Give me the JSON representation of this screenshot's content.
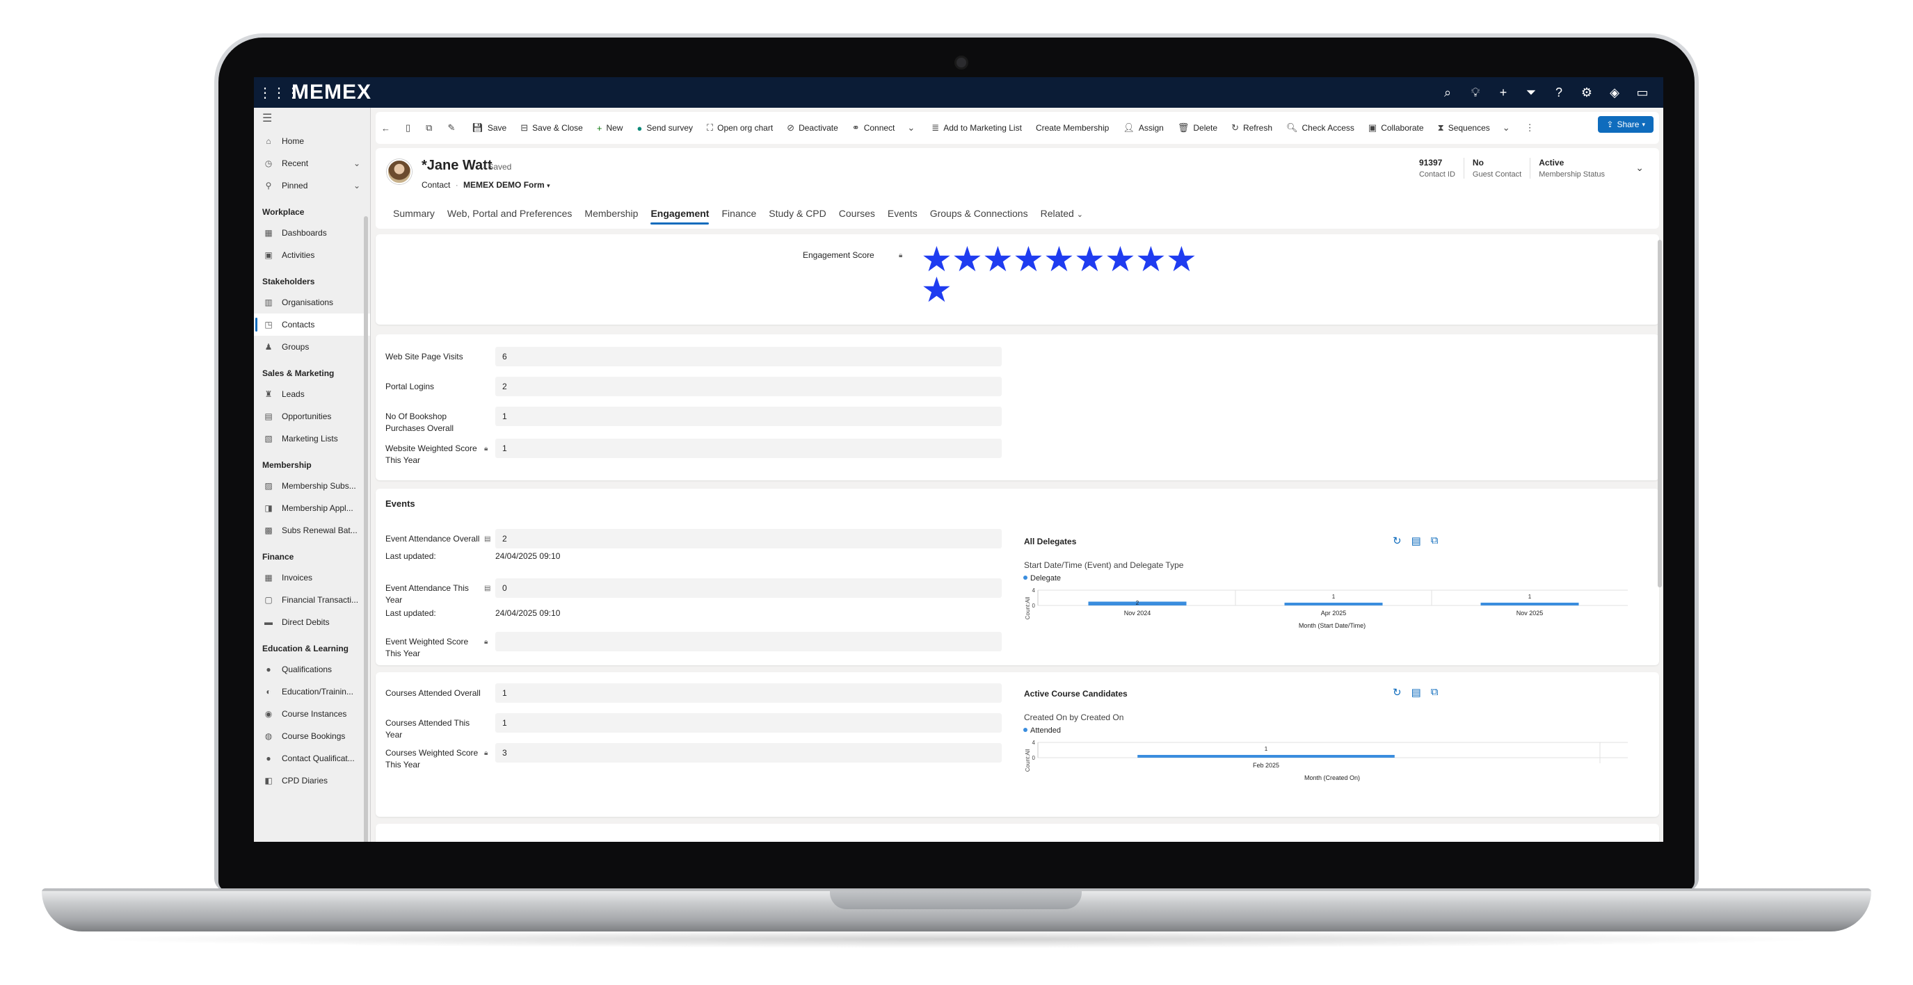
{
  "app": {
    "brand": "MEMEX"
  },
  "nav": {
    "top": [
      {
        "label": "Home",
        "icon": "home-icon"
      },
      {
        "label": "Recent",
        "icon": "clock-icon",
        "expandable": true
      },
      {
        "label": "Pinned",
        "icon": "pin-icon",
        "expandable": true
      }
    ],
    "groups": [
      {
        "title": "Workplace",
        "items": [
          {
            "label": "Dashboards"
          },
          {
            "label": "Activities"
          }
        ]
      },
      {
        "title": "Stakeholders",
        "items": [
          {
            "label": "Organisations"
          },
          {
            "label": "Contacts",
            "selected": true
          },
          {
            "label": "Groups"
          }
        ]
      },
      {
        "title": "Sales & Marketing",
        "items": [
          {
            "label": "Leads"
          },
          {
            "label": "Opportunities"
          },
          {
            "label": "Marketing Lists"
          }
        ]
      },
      {
        "title": "Membership",
        "items": [
          {
            "label": "Membership Subs..."
          },
          {
            "label": "Membership Appl..."
          },
          {
            "label": "Subs Renewal Bat..."
          }
        ]
      },
      {
        "title": "Finance",
        "items": [
          {
            "label": "Invoices"
          },
          {
            "label": "Financial Transacti..."
          },
          {
            "label": "Direct Debits"
          }
        ]
      },
      {
        "title": "Education & Learning",
        "items": [
          {
            "label": "Qualifications"
          },
          {
            "label": "Education/Trainin..."
          },
          {
            "label": "Course Instances"
          },
          {
            "label": "Course Bookings"
          },
          {
            "label": "Contact Qualificat..."
          },
          {
            "label": "CPD Diaries"
          }
        ]
      }
    ]
  },
  "commands": [
    {
      "label": "",
      "icon": "back-arrow-icon"
    },
    {
      "label": "",
      "icon": "form-icon"
    },
    {
      "label": "",
      "icon": "open-new-window-icon"
    },
    {
      "label": "",
      "icon": "edit-form-icon"
    },
    {
      "label": "Save",
      "icon": "save-icon"
    },
    {
      "label": "Save & Close",
      "icon": "save-close-icon"
    },
    {
      "label": "New",
      "icon": "plus-icon"
    },
    {
      "label": "Send survey",
      "icon": "survey-icon"
    },
    {
      "label": "Open org chart",
      "icon": "org-chart-icon"
    },
    {
      "label": "Deactivate",
      "icon": "deactivate-icon"
    },
    {
      "label": "Connect",
      "icon": "connect-icon"
    },
    {
      "label": "",
      "icon": "chevron-down-icon"
    },
    {
      "label": "Add to Marketing List",
      "icon": "marketing-list-icon"
    },
    {
      "label": "Create Membership",
      "icon": ""
    },
    {
      "label": "Assign",
      "icon": "assign-icon"
    },
    {
      "label": "Delete",
      "icon": "delete-icon"
    },
    {
      "label": "Refresh",
      "icon": "refresh-icon"
    },
    {
      "label": "Check Access",
      "icon": "check-access-icon"
    },
    {
      "label": "Collaborate",
      "icon": "collaborate-icon"
    },
    {
      "label": "Sequences",
      "icon": "sequences-icon"
    },
    {
      "label": "",
      "icon": "chevron-down-icon"
    },
    {
      "label": "",
      "icon": "more-icon"
    }
  ],
  "share_label": "Share",
  "record": {
    "name": "*Jane Watt",
    "saved": "- Saved",
    "entity": "Contact",
    "form": "MEMEX DEMO Form",
    "header_fields": [
      {
        "value": "91397",
        "label": "Contact ID"
      },
      {
        "value": "No",
        "label": "Guest Contact"
      },
      {
        "value": "Active",
        "label": "Membership Status"
      }
    ]
  },
  "tabs": [
    "Summary",
    "Web, Portal and Preferences",
    "Membership",
    "Engagement",
    "Finance",
    "Study & CPD",
    "Courses",
    "Events",
    "Groups & Connections",
    "Related"
  ],
  "active_tab": "Engagement",
  "engagement": {
    "label": "Engagement Score",
    "stars": 10
  },
  "web": [
    {
      "label": "Web Site Page Visits",
      "value": "6"
    },
    {
      "label": "Portal Logins",
      "value": "2"
    },
    {
      "label": "No Of Bookshop Purchases Overall",
      "value": "1"
    },
    {
      "label": "Website Weighted Score This Year",
      "value": "1"
    }
  ],
  "events": {
    "title": "Events",
    "fields": [
      {
        "label": "Event Attendance Overall",
        "value": "2",
        "updated_label": "Last updated:",
        "updated": "24/04/2025 09:10"
      },
      {
        "label": "Event Attendance This Year",
        "value": "0",
        "updated_label": "Last updated:",
        "updated": "24/04/2025 09:10"
      },
      {
        "label": "Event Weighted Score This Year",
        "value": ""
      }
    ],
    "chart": {
      "title": "All Delegates",
      "subtitle": "Start Date/Time (Event) and Delegate Type"
    }
  },
  "courses": {
    "fields": [
      {
        "label": "Courses Attended Overall",
        "value": "1"
      },
      {
        "label": "Courses Attended This Year",
        "value": "1"
      },
      {
        "label": "Courses Weighted Score This Year",
        "value": "3"
      }
    ],
    "chart": {
      "title": "Active Course Candidates",
      "subtitle": "Created On by Created On"
    }
  },
  "chart_data": [
    {
      "type": "bar",
      "title": "All Delegates",
      "subtitle": "Start Date/Time (Event) and Delegate Type",
      "categories": [
        "Nov 2024",
        "Apr 2025",
        "Nov 2025"
      ],
      "series": [
        {
          "name": "Delegate",
          "values": [
            2,
            1,
            1
          ]
        }
      ],
      "xlabel": "Month (Start Date/Time)",
      "ylabel": "Count:All",
      "yticks": [
        "4",
        "0"
      ],
      "ylim": [
        0,
        4
      ],
      "legend": "top-left",
      "color": "#3a8dde"
    },
    {
      "type": "bar",
      "title": "Active Course Candidates",
      "subtitle": "Created On by Created On",
      "categories": [
        "Feb 2025"
      ],
      "series": [
        {
          "name": "Attended",
          "values": [
            1
          ]
        }
      ],
      "xlabel": "Month (Created On)",
      "ylabel": "Count:All",
      "yticks": [
        "4",
        "0"
      ],
      "ylim": [
        0,
        4
      ],
      "legend": "top-left",
      "color": "#3a8dde"
    }
  ]
}
